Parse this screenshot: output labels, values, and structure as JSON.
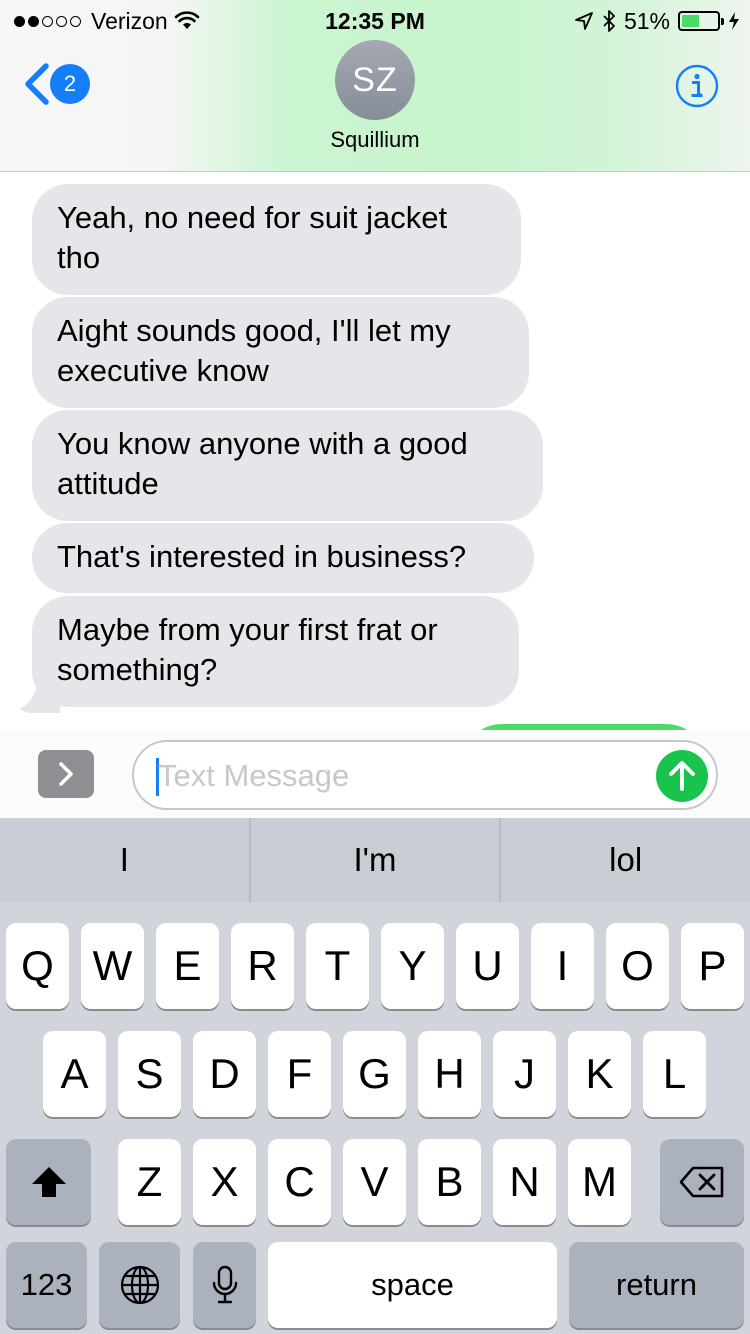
{
  "status_bar": {
    "carrier": "Verizon",
    "time": "12:35 PM",
    "battery": "51%",
    "battery_level": 0.51,
    "signal_bars": 2,
    "signal_total": 5
  },
  "nav": {
    "back_badge": "2",
    "avatar_initials": "SZ",
    "contact_name": "Squillium"
  },
  "messages": [
    {
      "direction": "received",
      "line1": "Yeah, no need for suit jacket",
      "line2": "tho"
    },
    {
      "direction": "received",
      "line1": "Aight sounds good, I'll let my",
      "line2": "executive know"
    },
    {
      "direction": "received",
      "line1": "You know anyone with a good",
      "line2": "attitude"
    },
    {
      "direction": "received",
      "line1": "That's interested in business?"
    },
    {
      "direction": "received",
      "line1": "Maybe from your first frat or",
      "line2": "something?"
    }
  ],
  "input": {
    "placeholder": "Text Message",
    "value": ""
  },
  "keyboard": {
    "predictions": [
      "I",
      "I'm",
      "lol"
    ],
    "row1": [
      "Q",
      "W",
      "E",
      "R",
      "T",
      "Y",
      "U",
      "I",
      "O",
      "P"
    ],
    "row2": [
      "A",
      "S",
      "D",
      "F",
      "G",
      "H",
      "J",
      "K",
      "L"
    ],
    "row3": [
      "Z",
      "X",
      "C",
      "V",
      "B",
      "N",
      "M"
    ],
    "numbers_label": "123",
    "space_label": "space",
    "return_label": "return"
  },
  "colors": {
    "accent_blue": "#157efb",
    "received_bubble": "#e5e5ea",
    "send_green": "#19c44d",
    "battery_green": "#4cd964"
  },
  "icons": [
    "wifi-icon",
    "location-arrow-icon",
    "bluetooth-icon",
    "charging-bolt-icon",
    "chevron-left-icon",
    "info-icon",
    "chevron-right-icon",
    "arrow-up-icon",
    "shift-icon",
    "backspace-icon",
    "globe-icon",
    "microphone-icon"
  ]
}
